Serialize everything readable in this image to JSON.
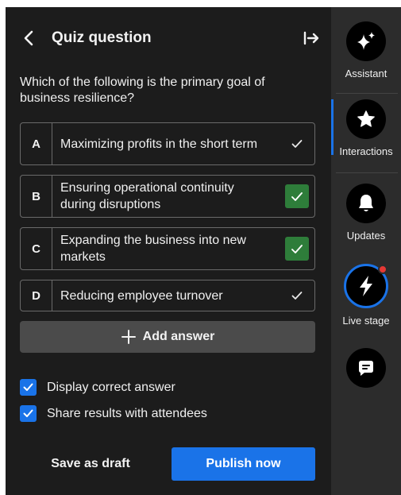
{
  "header": {
    "title": "Quiz question"
  },
  "question": {
    "text": "Which of the following is the primary goal of business resilience?"
  },
  "answers": [
    {
      "letter": "A",
      "text": "Maximizing profits in the short term",
      "correct": false
    },
    {
      "letter": "B",
      "text": "Ensuring operational continuity during disruptions",
      "correct": true
    },
    {
      "letter": "C",
      "text": "Expanding the business into new markets",
      "correct": true
    },
    {
      "letter": "D",
      "text": "Reducing employee turnover",
      "correct": false
    }
  ],
  "add_answer": {
    "label": "Add answer"
  },
  "options": [
    {
      "label": "Display correct answer",
      "checked": true
    },
    {
      "label": "Share results with attendees",
      "checked": true
    }
  ],
  "footer": {
    "save_draft_label": "Save as draft",
    "publish_label": "Publish now"
  },
  "rail": {
    "items": [
      {
        "label": "Assistant",
        "icon": "sparkle-icon"
      },
      {
        "label": "Interactions",
        "icon": "star-icon",
        "active": true
      },
      {
        "label": "Updates",
        "icon": "bell-icon"
      },
      {
        "label": "Live stage",
        "icon": "lightning-icon"
      },
      {
        "label": "",
        "icon": "chat-icon"
      }
    ]
  },
  "colors": {
    "panel_bg": "#1c1c1c",
    "rail_bg": "#2c2c2c",
    "accent": "#1a73e8",
    "correct_green": "#2e7d3a",
    "live_dot": "#e53935"
  }
}
